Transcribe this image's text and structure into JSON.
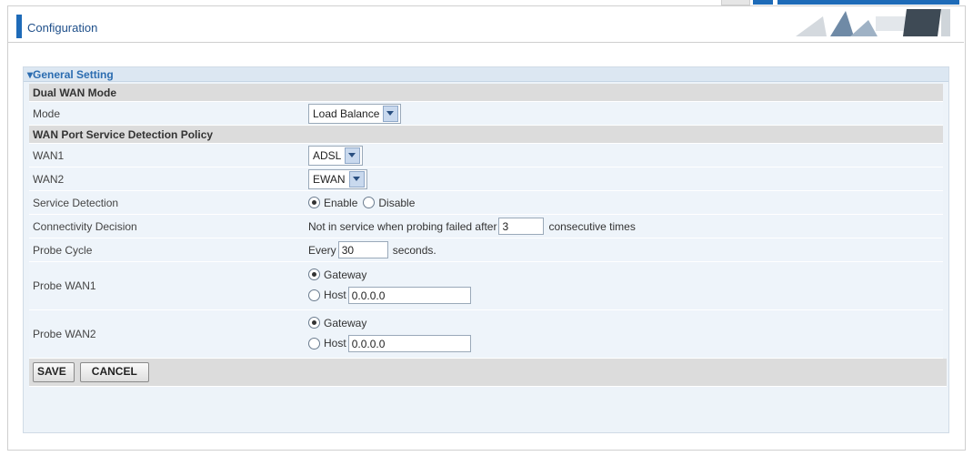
{
  "header": {
    "title": "Configuration"
  },
  "panel": {
    "title": "▾General Setting"
  },
  "sections": {
    "dual_wan": "Dual WAN Mode",
    "detection_policy": "WAN Port Service Detection Policy"
  },
  "mode": {
    "label": "Mode",
    "value": "Load Balance"
  },
  "wan1": {
    "label": "WAN1",
    "value": "ADSL"
  },
  "wan2": {
    "label": "WAN2",
    "value": "EWAN"
  },
  "service_detection": {
    "label": "Service Detection",
    "options": [
      "Enable",
      "Disable"
    ],
    "selected": "Enable"
  },
  "connectivity": {
    "label": "Connectivity Decision",
    "prefix": "Not in service when probing failed after",
    "value": "3",
    "suffix": "consecutive times"
  },
  "probe_cycle": {
    "label": "Probe Cycle",
    "prefix": "Every",
    "value": "30",
    "suffix": "seconds."
  },
  "probe_wan1": {
    "label": "Probe WAN1",
    "gateway_label": "Gateway",
    "host_label": "Host",
    "host_value": "0.0.0.0",
    "selected": "Gateway"
  },
  "probe_wan2": {
    "label": "Probe WAN2",
    "gateway_label": "Gateway",
    "host_label": "Host",
    "host_value": "0.0.0.0",
    "selected": "Gateway"
  },
  "buttons": {
    "save": "SAVE",
    "cancel": "CANCEL"
  },
  "colors": {
    "accent": "#1e6bb8",
    "panel_bg": "#edf3f9",
    "section_bg": "#dcdcdc"
  }
}
